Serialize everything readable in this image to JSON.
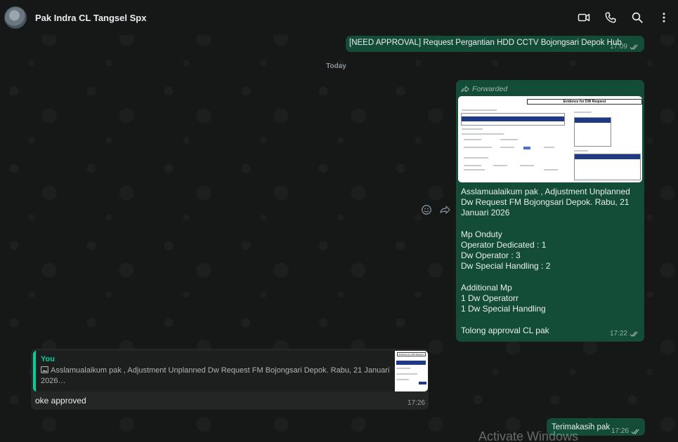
{
  "header": {
    "contact_name": "Pak Indra CL Tangsel Spx",
    "icons": [
      "video-call-icon",
      "voice-call-icon",
      "search-icon",
      "menu-icon"
    ]
  },
  "messages": {
    "m1": {
      "text": "[NEED APPROVAL] Request Pergantian HDD CCTV Bojongsari Depok Hub",
      "time": "17:09"
    },
    "day_separator": "Today",
    "m2": {
      "forwarded_label": "Forwarded",
      "image_title": "Evidence for DW Request",
      "text": "Asslamualaikum pak , Adjustment Unplanned Dw Request FM Bojongsari Depok. Rabu, 21 Januari 2026\n\nMp Onduty\nOperator Dedicated : 1\nDw Operator : 3\nDw Special Handling : 2\n\nAdditional Mp\n1 Dw Operatorr\n1 Dw Special Handling\n\nTolong approval CL pak",
      "time": "17:22"
    },
    "m3": {
      "quote_author": "You",
      "quote_text": "Asslamualaikum pak , Adjustment Unplanned Dw Request FM Bojongsari Depok. Rabu, 21 Januari 2026…",
      "quote_thumb_title": "Evidence for DW Request",
      "text": "oke approved",
      "time": "17:26"
    },
    "m4": {
      "text": "Terimakasih pak",
      "time": "17:26"
    }
  },
  "watermark": "Activate Windows",
  "colors": {
    "outgoing_bubble": "#144d37",
    "incoming_bubble": "#242626",
    "accent": "#06cf9c",
    "background": "#161717"
  }
}
